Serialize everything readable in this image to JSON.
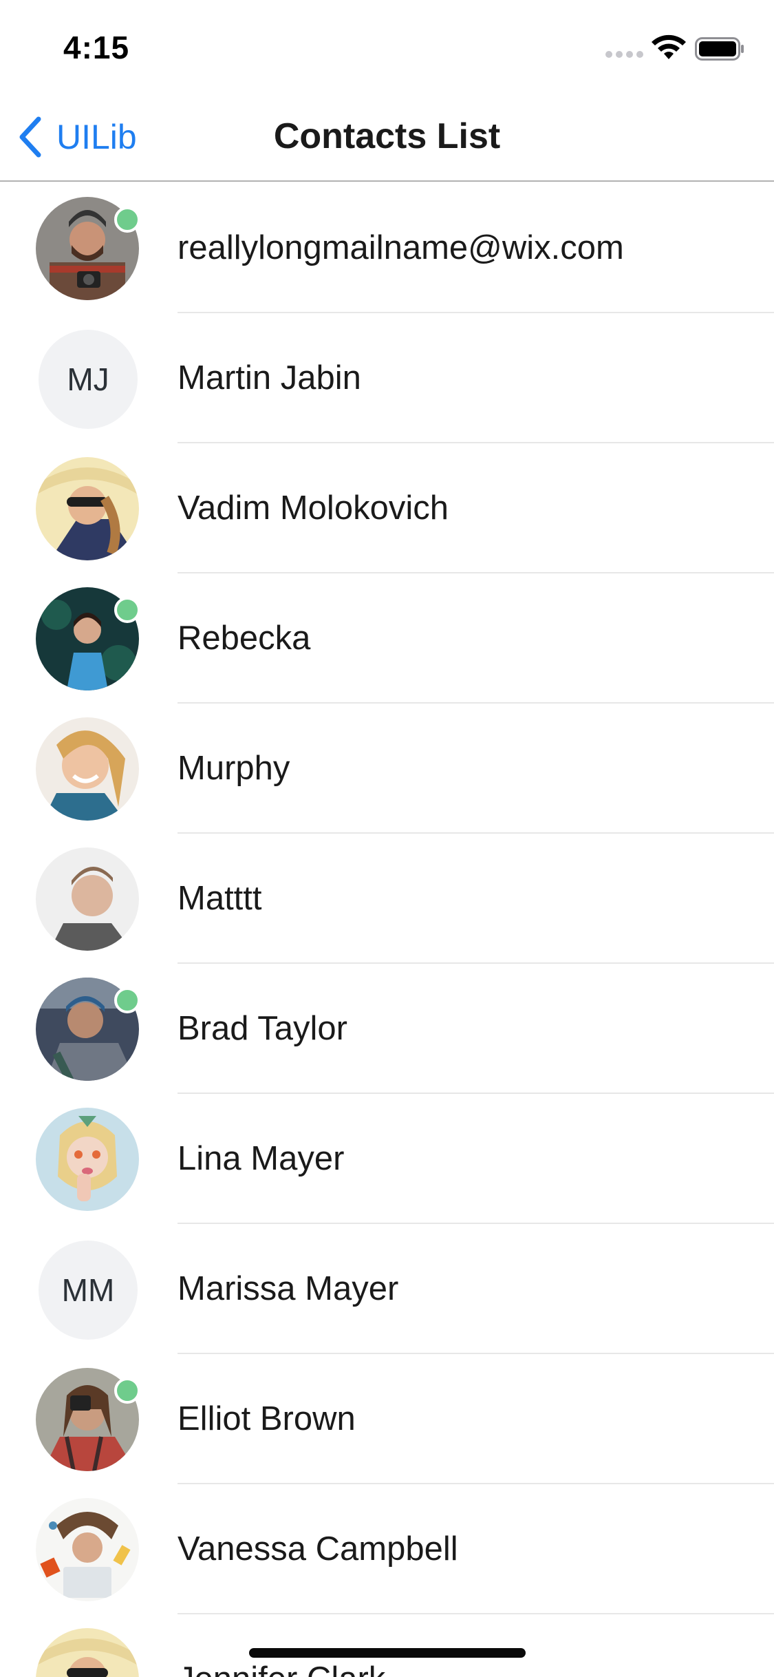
{
  "status_bar": {
    "time": "4:15"
  },
  "nav": {
    "back_label": "UILib",
    "title": "Contacts List",
    "accent_color": "#1f7ef0"
  },
  "contacts": [
    {
      "name": "reallylongmailname@wix.com",
      "avatar": "photo",
      "online": true
    },
    {
      "name": "Martin Jabin",
      "initials": "MJ",
      "avatar": "initials",
      "online": false
    },
    {
      "name": "Vadim Molokovich",
      "avatar": "photo",
      "online": false
    },
    {
      "name": "Rebecka",
      "avatar": "photo",
      "online": true
    },
    {
      "name": "Murphy",
      "avatar": "photo",
      "online": false
    },
    {
      "name": "Matttt",
      "avatar": "photo",
      "online": false
    },
    {
      "name": "Brad Taylor",
      "avatar": "photo",
      "online": true
    },
    {
      "name": "Lina Mayer",
      "avatar": "photo",
      "online": false
    },
    {
      "name": "Marissa Mayer",
      "initials": "MM",
      "avatar": "initials",
      "online": false
    },
    {
      "name": "Elliot Brown",
      "avatar": "photo",
      "online": true
    },
    {
      "name": "Vanessa Campbell",
      "avatar": "photo",
      "online": false
    },
    {
      "name": "Jennifer Clark",
      "avatar": "photo",
      "online": false
    }
  ],
  "online_color": "#6fcc8c"
}
